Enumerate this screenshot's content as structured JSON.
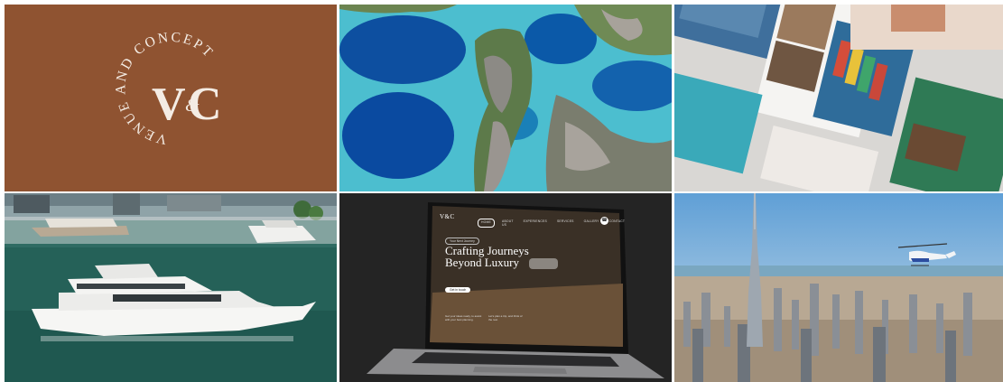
{
  "logo_tile": {
    "arc_text": "VENUE AND CONCEPT",
    "monogram_v": "V",
    "monogram_amp": "&",
    "monogram_c": "C",
    "background_color": "#8f5331",
    "text_color": "#f4ece4"
  },
  "laptop_site": {
    "logo": "V&C",
    "nav_items": [
      "HOME",
      "ABOUT US",
      "EXPERIENCES",
      "SERVICES",
      "GALLERY",
      "CONTACT"
    ],
    "active_nav": "HOME",
    "phone_icon": "phone-icon",
    "pill_label": "Your Next Journey",
    "headline_line1": "Crafting Journeys",
    "headline_line2": "Beyond Luxury",
    "cta_label": "Get in touch",
    "feature_1": "Get your ideas ready, to assist with your best planning.",
    "feature_2": "Let's plan a trip, and think of the rest."
  },
  "colors": {
    "brand_brown": "#8f5331",
    "laptop_bg": "#242424"
  }
}
